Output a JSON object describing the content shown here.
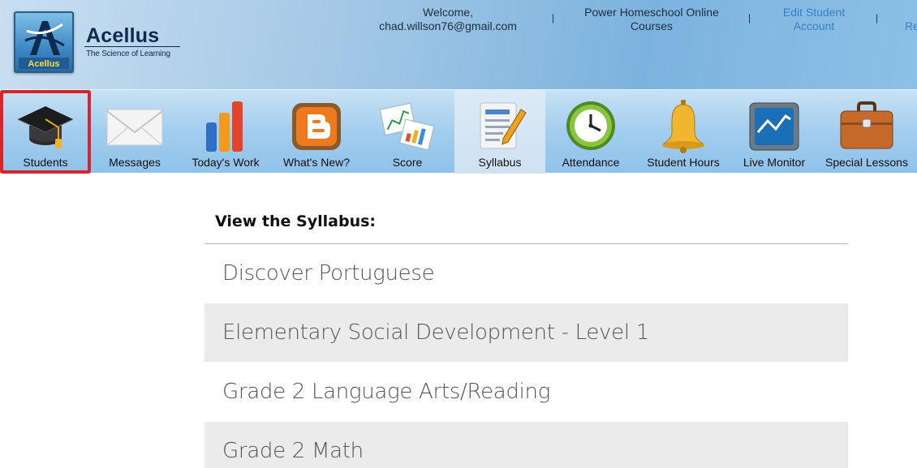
{
  "logo": {
    "name": "Acellus",
    "tagline": "The Science of Learning",
    "badge": "Acellus"
  },
  "header": {
    "welcome": "Welcome,",
    "email": "chad.willson76@gmail.com",
    "org_line1": "Power Homeschool Online",
    "org_line2": "Courses",
    "edit_line1": "Edit Student",
    "edit_line2": "Account",
    "cut_link": "Re",
    "separator": "|"
  },
  "toolbar": {
    "items": [
      {
        "label": "Students",
        "icon": "graduation-cap-icon"
      },
      {
        "label": "Messages",
        "icon": "envelope-icon"
      },
      {
        "label": "Today's Work",
        "icon": "bar-chart-icon"
      },
      {
        "label": "What's New?",
        "icon": "blogger-icon"
      },
      {
        "label": "Score",
        "icon": "score-charts-icon"
      },
      {
        "label": "Syllabus",
        "icon": "document-pencil-icon"
      },
      {
        "label": "Attendance",
        "icon": "clock-icon"
      },
      {
        "label": "Student Hours",
        "icon": "bell-icon"
      },
      {
        "label": "Live Monitor",
        "icon": "monitor-icon"
      },
      {
        "label": "Special Lessons",
        "icon": "briefcase-icon"
      }
    ]
  },
  "syllabus": {
    "title": "View the Syllabus:",
    "courses": [
      "Discover Portuguese",
      "Elementary Social Development - Level 1",
      "Grade 2 Language Arts/Reading",
      "Grade 2 Math"
    ]
  },
  "colors": {
    "selected_border": "#d8252b",
    "link": "#3a7ec7",
    "row_alt": "#ebebeb"
  }
}
